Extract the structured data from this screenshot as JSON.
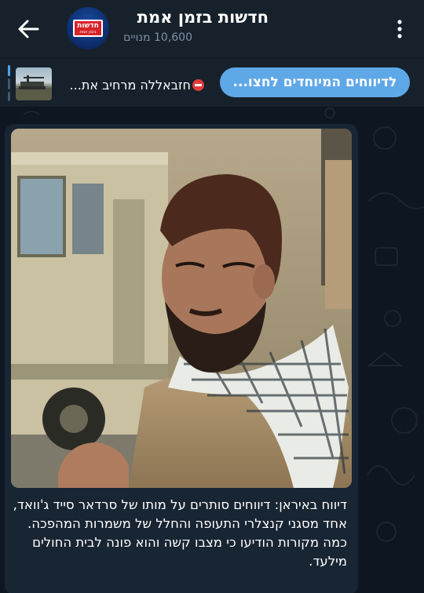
{
  "header": {
    "title": "חדשות בזמן אמת",
    "subscribers": "10,600 מנויים",
    "avatar_logo_big": "חדשות",
    "avatar_logo_small": "בזמן אמת"
  },
  "pinned": {
    "text": "חזבאללה מרחיב את...",
    "button_label": "לדיווחים המיוחדים לחצו..."
  },
  "message": {
    "caption": "דיווח באיראן: דיווחים סותרים על מותו של סרדאר סייד ג'וואד, אחד מסגני קנצלרי התעופה והחלל של משמרות המהפכה. כמה מקורות הודיעו כי מצבו קשה והוא פונה לבית החולים מילעד."
  },
  "colors": {
    "header_bg": "#17212b",
    "chat_bg": "#0e1621",
    "bubble_bg": "#182533",
    "accent_button": "#5fa8e8",
    "muted_text": "#7f91a4"
  },
  "icons": {
    "back": "arrow-left-icon",
    "menu": "more-vertical-icon",
    "pinned_marker": "no-entry-icon"
  }
}
